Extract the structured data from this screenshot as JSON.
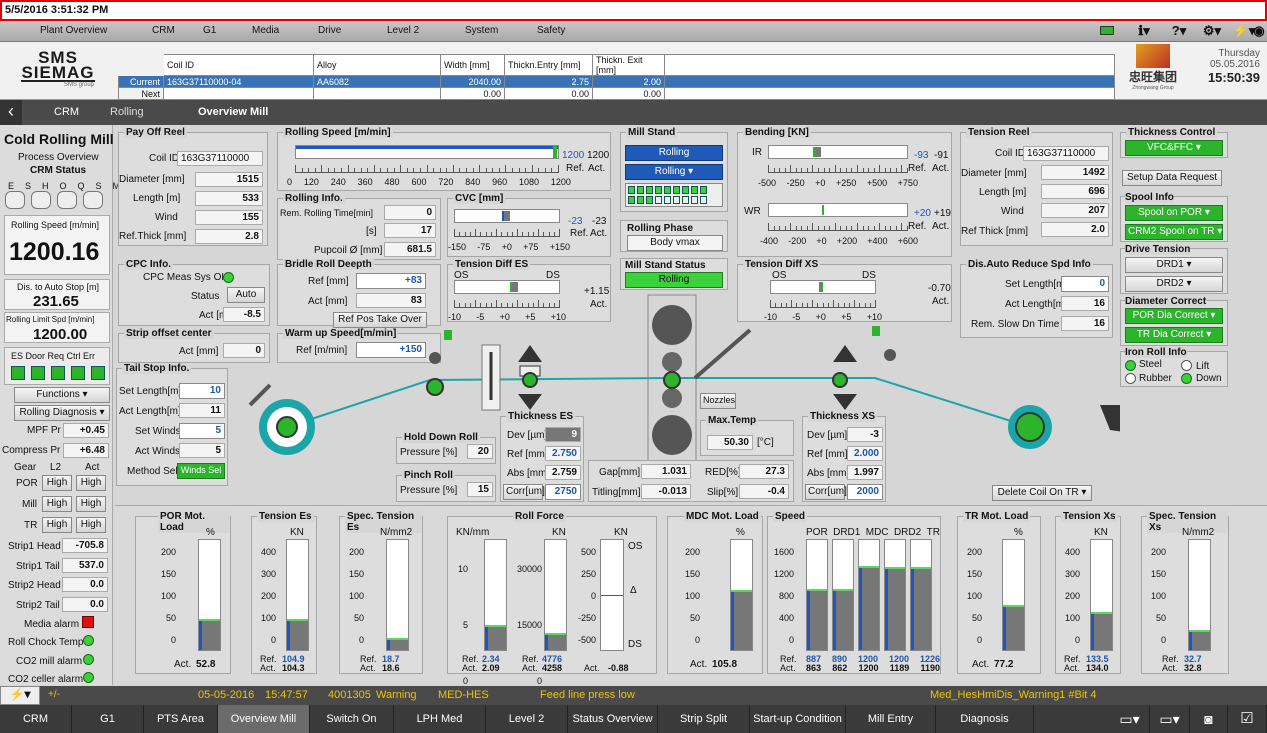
{
  "titlebar": {
    "datetime": "5/5/2016 3:51:32 PM"
  },
  "menu": {
    "items": [
      "Plant Overview",
      "CRM",
      "G1",
      "Media",
      "Drive",
      "Level 2",
      "System",
      "Safety"
    ]
  },
  "header": {
    "logo_line1": "SMS",
    "logo_line2": "SIEMAG",
    "logo_line3": "SMS group",
    "columns": [
      "Coil ID",
      "Alloy",
      "Width [mm]",
      "Thickn.Entry [mm]",
      "Thickn. Exit [mm]"
    ],
    "rows": [
      {
        "label": "Current",
        "coil_id": "163G37110000-04",
        "alloy": "AA6082",
        "width": "2040.00",
        "entry": "2.75",
        "exit": "2.00"
      },
      {
        "label": "Next",
        "coil_id": "",
        "alloy": "",
        "width": "0.00",
        "entry": "0.00",
        "exit": "0.00"
      }
    ],
    "partner_logo": "忠旺集团",
    "partner_sub": "Zhongwang Group",
    "day": "Thursday",
    "date": "05.05.2016",
    "time": "15:50:39"
  },
  "nav": {
    "crumbs": [
      "CRM",
      "Rolling",
      "Overview Mill"
    ]
  },
  "left": {
    "title": "Cold Rolling Mill",
    "subtitle": "Process Overview",
    "status_label": "CRM Status",
    "status_codes": [
      "ES",
      "HO",
      "QS",
      "MS"
    ],
    "speed_label": "Rolling Speed [m/min]",
    "speed_value": "1200.16",
    "dist_label": "Dis. to Auto Stop [m]",
    "dist_value": "231.65",
    "limit_label": "Rolling Limit Spd [m/min]",
    "limit_value": "1200.00",
    "es_label": "ES Door Req Ctrl Err",
    "functions": "Functions",
    "diagnosis": "Rolling Diagnosis",
    "mpf_label": "MPF Pr",
    "mpf_value": "+0.45",
    "cpr_label": "Compress Pr",
    "cpr_value": "+6.48",
    "gear_hdr": [
      "Gear",
      "L2",
      "Act"
    ],
    "gears": [
      {
        "name": "POR",
        "l2": "High",
        "act": "High"
      },
      {
        "name": "Mill",
        "l2": "High",
        "act": "High"
      },
      {
        "name": "TR",
        "l2": "High",
        "act": "High"
      }
    ],
    "strips": [
      {
        "name": "Strip1 Head",
        "value": "-705.8"
      },
      {
        "name": "Strip1 Tail",
        "value": "537.0"
      },
      {
        "name": "Strip2 Head",
        "value": "0.0"
      },
      {
        "name": "Strip2 Tail",
        "value": "0.0"
      }
    ],
    "alarms": [
      "Media  alarm",
      "Roll Chock Temp",
      "CO2 mill alarm",
      "CO2 celler alarm"
    ]
  },
  "payoff": {
    "title": "Pay Off Reel",
    "coil_label": "Coil ID",
    "coil": "163G37110000",
    "dia_label": "Diameter [mm]",
    "dia": "1515",
    "len_label": "Length [m]",
    "len": "533",
    "wind_label": "Wind",
    "wind": "155",
    "ref_label": "Ref.Thick [mm]",
    "ref": "2.8"
  },
  "speed": {
    "title": "Rolling Speed [m/min]",
    "ticks": [
      "0",
      "120",
      "240",
      "360",
      "480",
      "600",
      "720",
      "840",
      "960",
      "1080",
      "1200"
    ],
    "ref": "1200",
    "act": "1200",
    "ref_label": "Ref.",
    "act_label": "Act."
  },
  "rollinfo": {
    "title": "Rolling Info.",
    "rem_label": "Rem. Rolling Time[min]",
    "rem": "0",
    "s_label": "[s]",
    "s": "17",
    "pup_label": "Pupcoil Ø [mm]",
    "pup": "681.5"
  },
  "cvc": {
    "title": "CVC [mm]",
    "ticks": [
      "-150",
      "-75",
      "+0",
      "+75",
      "+150"
    ],
    "ref": "-23",
    "act": "-23",
    "ref_label": "Ref.",
    "act_label": "Act."
  },
  "millstand": {
    "title": "Mill Stand",
    "state": "Rolling",
    "mode": "Rolling"
  },
  "phase": {
    "title": "Rolling Phase",
    "value": "Body vmax"
  },
  "mss": {
    "title": "Mill Stand Status",
    "value": "Rolling"
  },
  "bending": {
    "title": "Bending [KN]",
    "ir_label": "IR",
    "ir_ticks": [
      "-500",
      "-250",
      "+0",
      "+250",
      "+500",
      "+750"
    ],
    "ir_ref": "-93",
    "ir_act": "-91",
    "wr_label": "WR",
    "wr_ticks": [
      "-400",
      "-200",
      "+0",
      "+200",
      "+400",
      "+600"
    ],
    "wr_ref": "+20",
    "wr_act": "+19",
    "ref_label": "Ref.",
    "act_label": "Act."
  },
  "tensionreel": {
    "title": "Tension Reel",
    "coil_label": "Coil ID",
    "coil": "163G37110000",
    "dia_label": "Diameter [mm]",
    "dia": "1492",
    "len_label": "Length [m]",
    "len": "696",
    "wind_label": "Wind",
    "wind": "207",
    "ref_label": "Ref Thick [mm]",
    "ref": "2.0"
  },
  "thick": {
    "title": "Thickness Control",
    "mode": "VFC&FFC",
    "setup": "Setup Data Request"
  },
  "spool": {
    "title": "Spool Info",
    "por": "Spool on POR",
    "crm": "CRM2 Spool on TR"
  },
  "drivet": {
    "title": "Drive Tension",
    "d1": "DRD1",
    "d2": "DRD2"
  },
  "diam": {
    "title": "Diameter Correct",
    "por": "POR Dia Correct",
    "tr": "TR Dia Correct"
  },
  "iron": {
    "title": "Iron Roll Info",
    "steel": "Steel",
    "lift": "Lift",
    "rubber": "Rubber",
    "down": "Down"
  },
  "cpc": {
    "title": "CPC Info.",
    "meas": "CPC Meas Sys OK",
    "status_label": "Status",
    "status": "Auto",
    "act_label": "Act [mm]",
    "act": "-8.5"
  },
  "bridle": {
    "title": "Bridle Roll Deepth",
    "ref_label": "Ref [mm]",
    "ref": "+83",
    "act_label": "Act [mm]",
    "act": "83",
    "btn": "Ref Pos Take Over"
  },
  "strip": {
    "title": "Strip offset center",
    "act_label": "Act [mm]",
    "act": "0"
  },
  "warm": {
    "title": "Warm up Speed[m/min]",
    "ref_label": "Ref [m/min]",
    "ref": "+150"
  },
  "tdes": {
    "title": "Tension Diff ES",
    "os": "OS",
    "ds": "DS",
    "val": "+1.15",
    "act": "Act.",
    "ticks": [
      "-10",
      "-5",
      "+0",
      "+5",
      "+10"
    ]
  },
  "tdxs": {
    "title": "Tension Diff XS",
    "os": "OS",
    "ds": "DS",
    "val": "-0.70",
    "act": "Act.",
    "ticks": [
      "-10",
      "-5",
      "+0",
      "+5",
      "+10"
    ]
  },
  "autored": {
    "title": "Dis.Auto Reduce Spd Info",
    "set_label": "Set Length[m]",
    "set": "0",
    "act_label": "Act Length[m]",
    "act": "16",
    "rem_label": "Rem. Slow Dn Time [s]",
    "rem": "16"
  },
  "tailstop": {
    "title": "Tail Stop Info.",
    "set_label": "Set Length[m]",
    "set": "10",
    "act_label": "Act Length[m]",
    "act": "11",
    "setw_label": "Set Winds",
    "setw": "5",
    "actw_label": "Act Winds",
    "actw": "5",
    "meth_label": "Method Sel.",
    "meth": "Winds Sel"
  },
  "holddown": {
    "title": "Hold Down Roll",
    "label": "Pressure [%]",
    "value": "20"
  },
  "pinch": {
    "title": "Pinch Roll",
    "label": "Pressure [%]",
    "value": "15"
  },
  "thes": {
    "title": "Thickness ES",
    "dev_label": "Dev [µm]",
    "dev": "9",
    "ref_label": "Ref [mm]",
    "ref": "2.750",
    "abs_label": "Abs [mm]",
    "abs": "2.759",
    "corr_label": "Corr[um]",
    "corr": "2750"
  },
  "mid": {
    "gap_label": "Gap[mm]",
    "gap": "1.031",
    "red_label": "RED[%]",
    "red": "27.3",
    "tilt_label": "Titling[mm]",
    "tilt": "-0.013",
    "slip_label": "Slip[%]",
    "slip": "-0.4"
  },
  "maxtemp": {
    "title": "Max.Temp",
    "value": "50.30",
    "unit": "[°C]"
  },
  "nozzles": "Nozzles",
  "thxs": {
    "title": "Thickness XS",
    "dev_label": "Dev [µm]",
    "dev": "-3",
    "ref_label": "Ref [mm]",
    "ref": "2.000",
    "abs_label": "Abs [mm]",
    "abs": "1.997",
    "corr_label": "Corr[um]",
    "corr": "2000"
  },
  "deletecoil": "Delete Coil On TR",
  "gauges": {
    "por": {
      "title": "POR Mot. Load",
      "unit": "%",
      "ticks": [
        "200",
        "150",
        "100",
        "50",
        "0"
      ],
      "act_label": "Act.",
      "act": "52.8",
      "level": 0.26
    },
    "tes": {
      "title": "Tension Es",
      "unit": "KN",
      "ticks": [
        "400",
        "300",
        "200",
        "100",
        "0"
      ],
      "ref_label": "Ref.",
      "ref": "104.9",
      "act_label": "Act.",
      "act": "104.3",
      "level": 0.26
    },
    "stes": {
      "title": "Spec. Tension Es",
      "unit": "N/mm2",
      "ticks": [
        "200",
        "150",
        "100",
        "50",
        "0"
      ],
      "ref_label": "Ref.",
      "ref": "18.7",
      "act_label": "Act.",
      "act": "18.6",
      "level": 0.09
    },
    "rf": {
      "title": "Roll Force",
      "u1": "KN/mm",
      "u2": "KN",
      "u3": "KN",
      "t1": [
        "10",
        "5",
        "0"
      ],
      "t2": [
        "30000",
        "15000",
        "0"
      ],
      "t3": [
        "500",
        "250",
        "0",
        "-250",
        "-500"
      ],
      "os": "OS",
      "ds": "DS",
      "ref1": "2.34",
      "act1": "2.09",
      "ref2": "4776",
      "act2": "4258",
      "act3": "-0.88",
      "ref_label": "Ref.",
      "act_label": "Act.",
      "level1": 0.21,
      "level2": 0.14
    },
    "mdc": {
      "title": "MDC Mot. Load",
      "unit": "%",
      "ticks": [
        "200",
        "150",
        "100",
        "50",
        "0"
      ],
      "act_label": "Act.",
      "act": "105.8",
      "level": 0.53
    },
    "spd": {
      "title": "Speed",
      "cols": [
        "POR",
        "DRD1",
        "MDC",
        "DRD2",
        "TR"
      ],
      "ticks": [
        "1600",
        "1200",
        "800",
        "400",
        "0"
      ],
      "refs": [
        "887",
        "890",
        "1200",
        "1200",
        "1226"
      ],
      "acts": [
        "863",
        "862",
        "1200",
        "1189",
        "1190"
      ],
      "ref_label": "Ref.",
      "act_label": "Act.",
      "levels": [
        0.54,
        0.54,
        0.75,
        0.74,
        0.74
      ]
    },
    "tr": {
      "title": "TR Mot. Load",
      "unit": "%",
      "ticks": [
        "200",
        "150",
        "100",
        "50",
        "0"
      ],
      "act_label": "Act.",
      "act": "77.2",
      "level": 0.39
    },
    "txs": {
      "title": "Tension Xs",
      "unit": "KN",
      "ticks": [
        "400",
        "300",
        "200",
        "100",
        "0"
      ],
      "ref_label": "Ref.",
      "ref": "133.5",
      "act_label": "Act.",
      "act": "134.0",
      "level": 0.33
    },
    "stxs": {
      "title": "Spec. Tension Xs",
      "unit": "N/mm2",
      "ticks": [
        "200",
        "150",
        "100",
        "50",
        "0"
      ],
      "ref_label": "Ref.",
      "ref": "32.7",
      "act_label": "Act.",
      "act": "32.8",
      "level": 0.16
    }
  },
  "status": {
    "pm": "+/-",
    "date": "05-05-2016",
    "time": "15:47:57",
    "code": "4001305",
    "type": "Warning",
    "src": "MED-HES",
    "msg": "Feed line press low",
    "tag": "Med_HesHmiDis_Warning1 #Bit 4"
  },
  "tabs": [
    "CRM",
    "G1",
    "PTS Area",
    "Overview Mill",
    "Switch On",
    "LPH Med",
    "Level 2",
    "Status Overview",
    "Strip Split",
    "Start-up Condition",
    "Mill Entry",
    "Diagnosis"
  ],
  "colors": {
    "accent": "#1f55a8",
    "ok": "#2db42d",
    "alarm": "#e01010",
    "strip": "#1ba5a8",
    "status": "#f2c200"
  }
}
